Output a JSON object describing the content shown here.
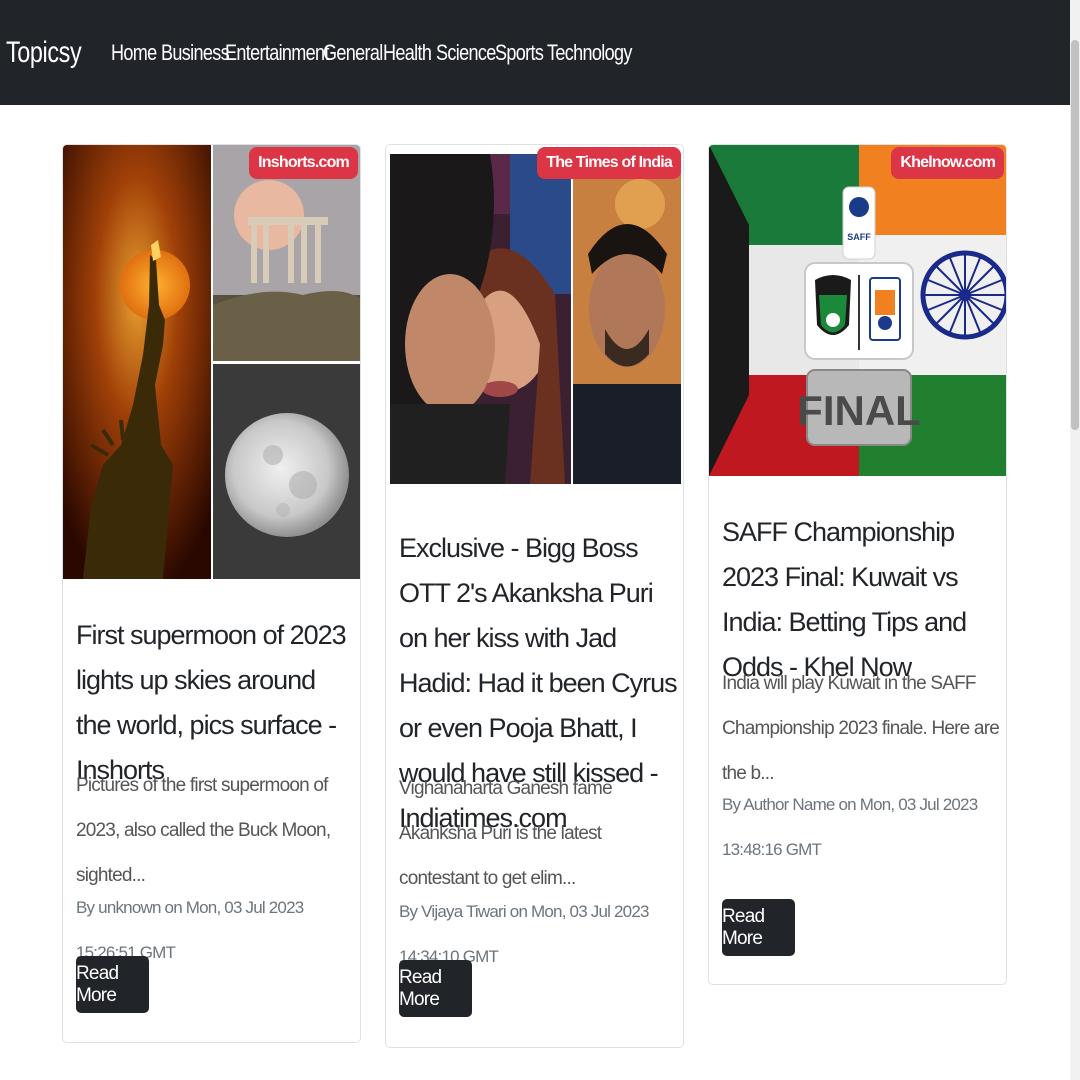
{
  "navbar": {
    "brand": "Topicsy",
    "links": [
      "Home",
      "Business",
      "Entertainment",
      "General",
      "Health",
      "Science",
      "Sports",
      "Technology"
    ]
  },
  "cards": [
    {
      "source": "Inshorts.com",
      "title": "First supermoon of 2023 lights up skies around the world, pics surface - Inshorts",
      "description": "Pictures of the first supermoon of 2023, also called the Buck Moon, sighted...",
      "meta": "By unknown on Mon, 03 Jul 2023 15:26:51 GMT",
      "button": "Read More"
    },
    {
      "source": "The Times of India",
      "title": "Exclusive - Bigg Boss OTT 2's Akanksha Puri on her kiss with Jad Hadid: Had it been Cyrus or even Pooja Bhatt, I would have still kissed - Indiatimes.com",
      "description": "Vighanaharta Ganesh fame Akanksha Puri is the latest contestant to get elim...",
      "meta": "By Vijaya Tiwari on Mon, 03 Jul 2023 14:34:10 GMT",
      "button": "Read More"
    },
    {
      "source": "Khelnow.com",
      "title": "SAFF Championship 2023 Final: Kuwait vs India: Betting Tips and Odds - Khel Now",
      "description": "India will play Kuwait in the SAFF Championship 2023 finale. Here are the b...",
      "meta": "By Author Name on Mon, 03 Jul 2023 13:48:16 GMT",
      "button": "Read More",
      "image_text": {
        "badge": "SAFF",
        "final": "FINAL",
        "crest_left": "KUWAIT",
        "crest_right": "INDIA"
      }
    }
  ],
  "colors": {
    "navbar": "#212529",
    "badge": "#dc3545",
    "button": "#212529"
  }
}
